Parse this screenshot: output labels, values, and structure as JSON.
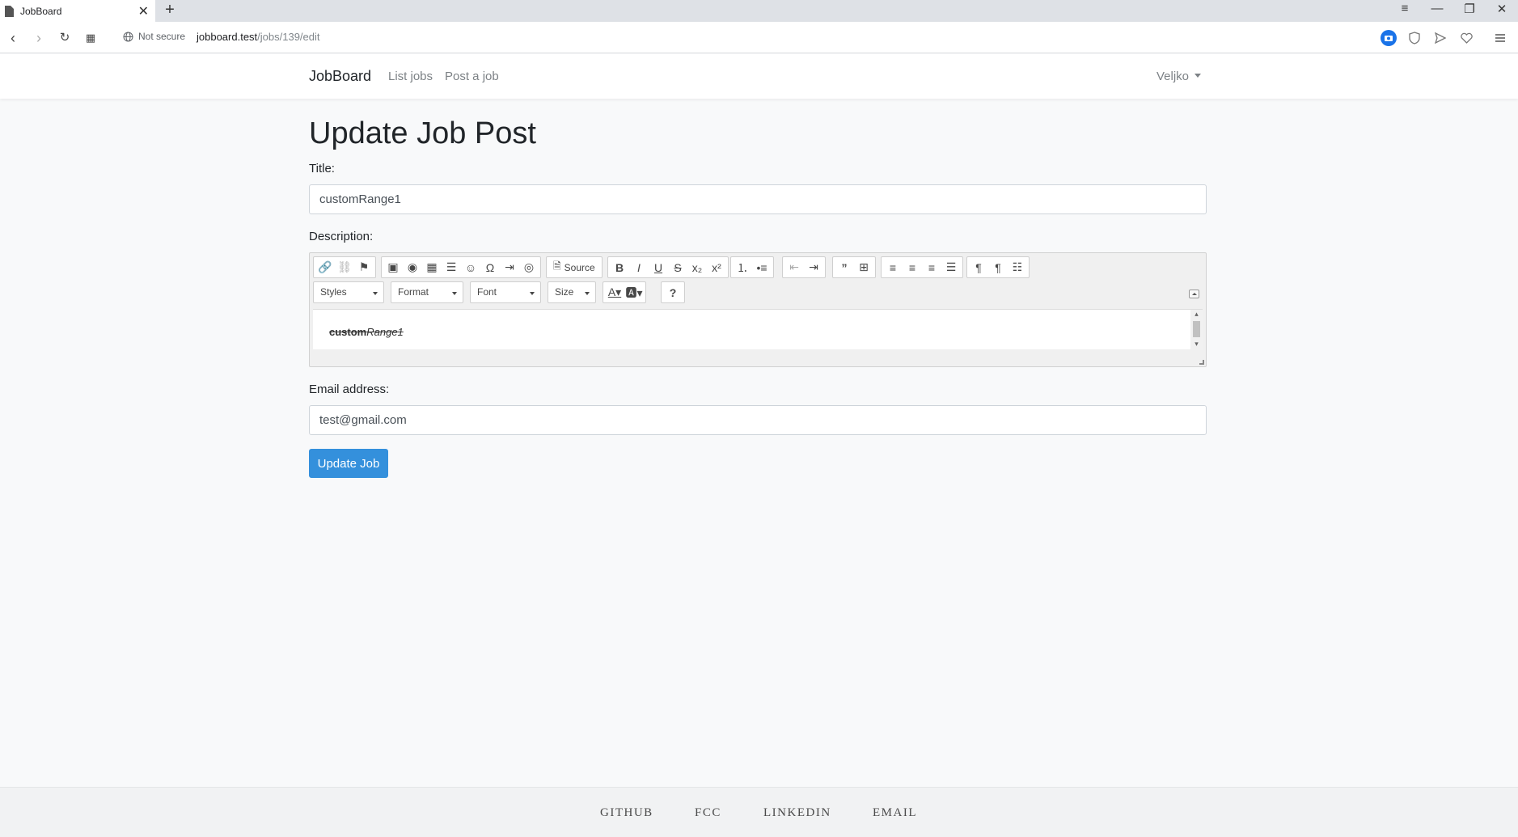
{
  "browser": {
    "tab_title": "JobBoard",
    "url_host": "jobboard.test",
    "url_path": "/jobs/139/edit",
    "security_label": "Not secure"
  },
  "navbar": {
    "brand": "JobBoard",
    "links": [
      "List jobs",
      "Post a job"
    ],
    "user": "Veljko"
  },
  "form": {
    "heading": "Update Job Post",
    "title_label": "Title:",
    "title_value": "customRange1",
    "description_label": "Description:",
    "description_bold": "custom",
    "description_italic": "Range1",
    "email_label": "Email address:",
    "email_value": "test@gmail.com",
    "submit_label": "Update Job"
  },
  "editor": {
    "source_label": "Source",
    "combos": [
      "Styles",
      "Format",
      "Font",
      "Size"
    ]
  },
  "footer": {
    "links": [
      "GITHUB",
      "FCC",
      "LINKEDIN",
      "EMAIL"
    ]
  },
  "colors": {
    "primary": "#3490dc",
    "background": "#f8f9fa",
    "accent_icon": "#1a73e8"
  }
}
